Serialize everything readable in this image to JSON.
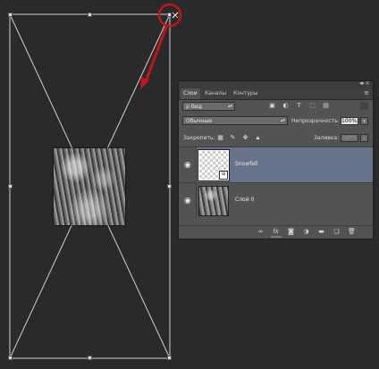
{
  "panel": {
    "collapse_icon": "double-chevron-icon",
    "menu_icon": "panel-menu-icon",
    "tabs": [
      {
        "label": "Слои",
        "active": true
      },
      {
        "label": "Каналы",
        "active": false
      },
      {
        "label": "Контуры",
        "active": false
      }
    ],
    "filter": {
      "label": "ρ Вид"
    },
    "filter_icons": [
      "image-filter-icon",
      "adjustment-filter-icon",
      "type-filter-icon",
      "shape-filter-icon",
      "smart-object-filter-icon"
    ],
    "blend_mode": "Обычные",
    "opacity_label": "Непрозрачность:",
    "opacity_value": "100%",
    "lock_label": "Закрепить:",
    "lock_icons": [
      "lock-transparent-icon",
      "lock-image-icon",
      "lock-position-icon",
      "lock-all-icon"
    ],
    "fill_label": "Заливка:",
    "fill_value": "100%",
    "layers": [
      {
        "name": "Snowfall",
        "selected": true,
        "thumb": "transparent",
        "smart_object": true
      },
      {
        "name": "Слой 0",
        "selected": false,
        "thumb": "photo",
        "smart_object": false
      }
    ],
    "bottom_icons": [
      "link-layers-icon",
      "fx-icon",
      "mask-icon",
      "adjustment-layer-icon",
      "group-folder-icon",
      "new-layer-icon",
      "trash-icon"
    ]
  },
  "colors": {
    "canvas_bg": "#2a2a2a",
    "panel_bg": "#535353",
    "selected_layer": "#66738a",
    "annotation_red": "#c0161c"
  }
}
